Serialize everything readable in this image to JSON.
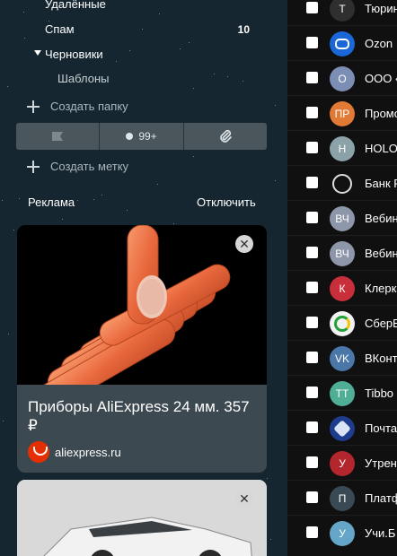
{
  "folders": {
    "deleted": "Удалённые",
    "spam": "Спам",
    "spam_count": "10",
    "drafts": "Черновики",
    "templates": "Шаблоны"
  },
  "create_folder": "Создать папку",
  "labels_bar": {
    "unread_count": "99+"
  },
  "create_label": "Создать метку",
  "ads": {
    "header": "Реклама",
    "disable": "Отключить",
    "card1": {
      "title": "Приборы AliExpress 24 мм. 357 ₽",
      "source": "aliexpress.ru"
    }
  },
  "mails": [
    {
      "initial": "T",
      "sender": "Тюрин",
      "color": "#2f2f2f"
    },
    {
      "initial": "",
      "sender": "Ozon",
      "color": "#1a67d8",
      "icon": "ozon-logo"
    },
    {
      "initial": "О",
      "sender": "ООО «",
      "color": "#7d8eb5"
    },
    {
      "initial": "ПР",
      "sender": "Промо",
      "color": "#e07a34"
    },
    {
      "initial": "Н",
      "sender": "HOLO",
      "color": "#8aa2a8"
    },
    {
      "initial": "",
      "sender": "Банк Р",
      "color": "#e9e9e9",
      "icon": "bank-logo"
    },
    {
      "initial": "ВЧ",
      "sender": "Вебин",
      "color": "#8d97a9"
    },
    {
      "initial": "ВЧ",
      "sender": "Вебин",
      "color": "#8d97a9"
    },
    {
      "initial": "К",
      "sender": "Клерк",
      "color": "#c92f3a"
    },
    {
      "initial": "",
      "sender": "СберБ",
      "color": "#f2f2f2",
      "icon": "sber-logo"
    },
    {
      "initial": "VK",
      "sender": "ВКонт",
      "color": "#4a76a8"
    },
    {
      "initial": "TT",
      "sender": "Tibbo",
      "color": "#4fae95"
    },
    {
      "initial": "",
      "sender": "Почта",
      "color": "#1e3c8c",
      "icon": "post-logo"
    },
    {
      "initial": "У",
      "sender": "Утрен",
      "color": "#b3262e"
    },
    {
      "initial": "П",
      "sender": "Платф",
      "color": "#3a4a55"
    },
    {
      "initial": "У",
      "sender": "Учи.Б",
      "color": "#64a5c8"
    }
  ]
}
